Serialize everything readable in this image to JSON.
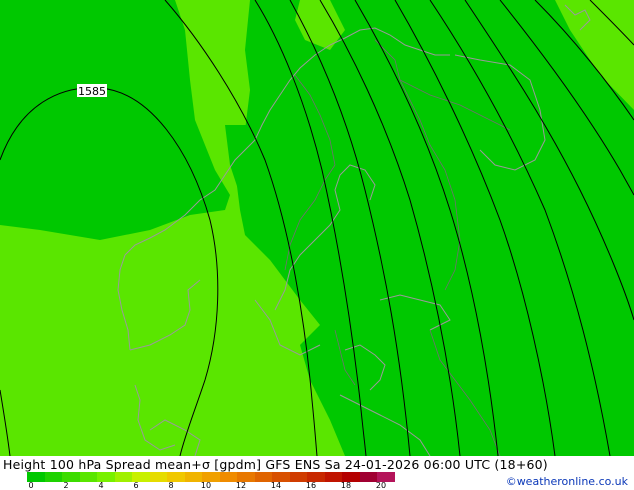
{
  "title": "Height 100 hPa Spread mean+σ [gpdm] GFS ENS Sa 24-01-2026 06:00 UTC (18+60)",
  "credit": "©weatheronline.co.uk",
  "contour_label": "1585",
  "legend": {
    "ticks": [
      "0",
      "2",
      "4",
      "6",
      "8",
      "10",
      "12",
      "14",
      "16",
      "18",
      "20"
    ],
    "colors": [
      "#00c800",
      "#1ed200",
      "#3cdc00",
      "#5ae600",
      "#78f000",
      "#a0f000",
      "#c8f000",
      "#e6dc00",
      "#f0c800",
      "#f0b400",
      "#f0a000",
      "#f08c00",
      "#e87800",
      "#e06400",
      "#d85000",
      "#d03c00",
      "#c82800",
      "#c01400",
      "#b40000",
      "#a00032",
      "#b4145a"
    ]
  },
  "fill_colors": {
    "green_dark": "#00c800",
    "green_light": "#5ae600"
  }
}
